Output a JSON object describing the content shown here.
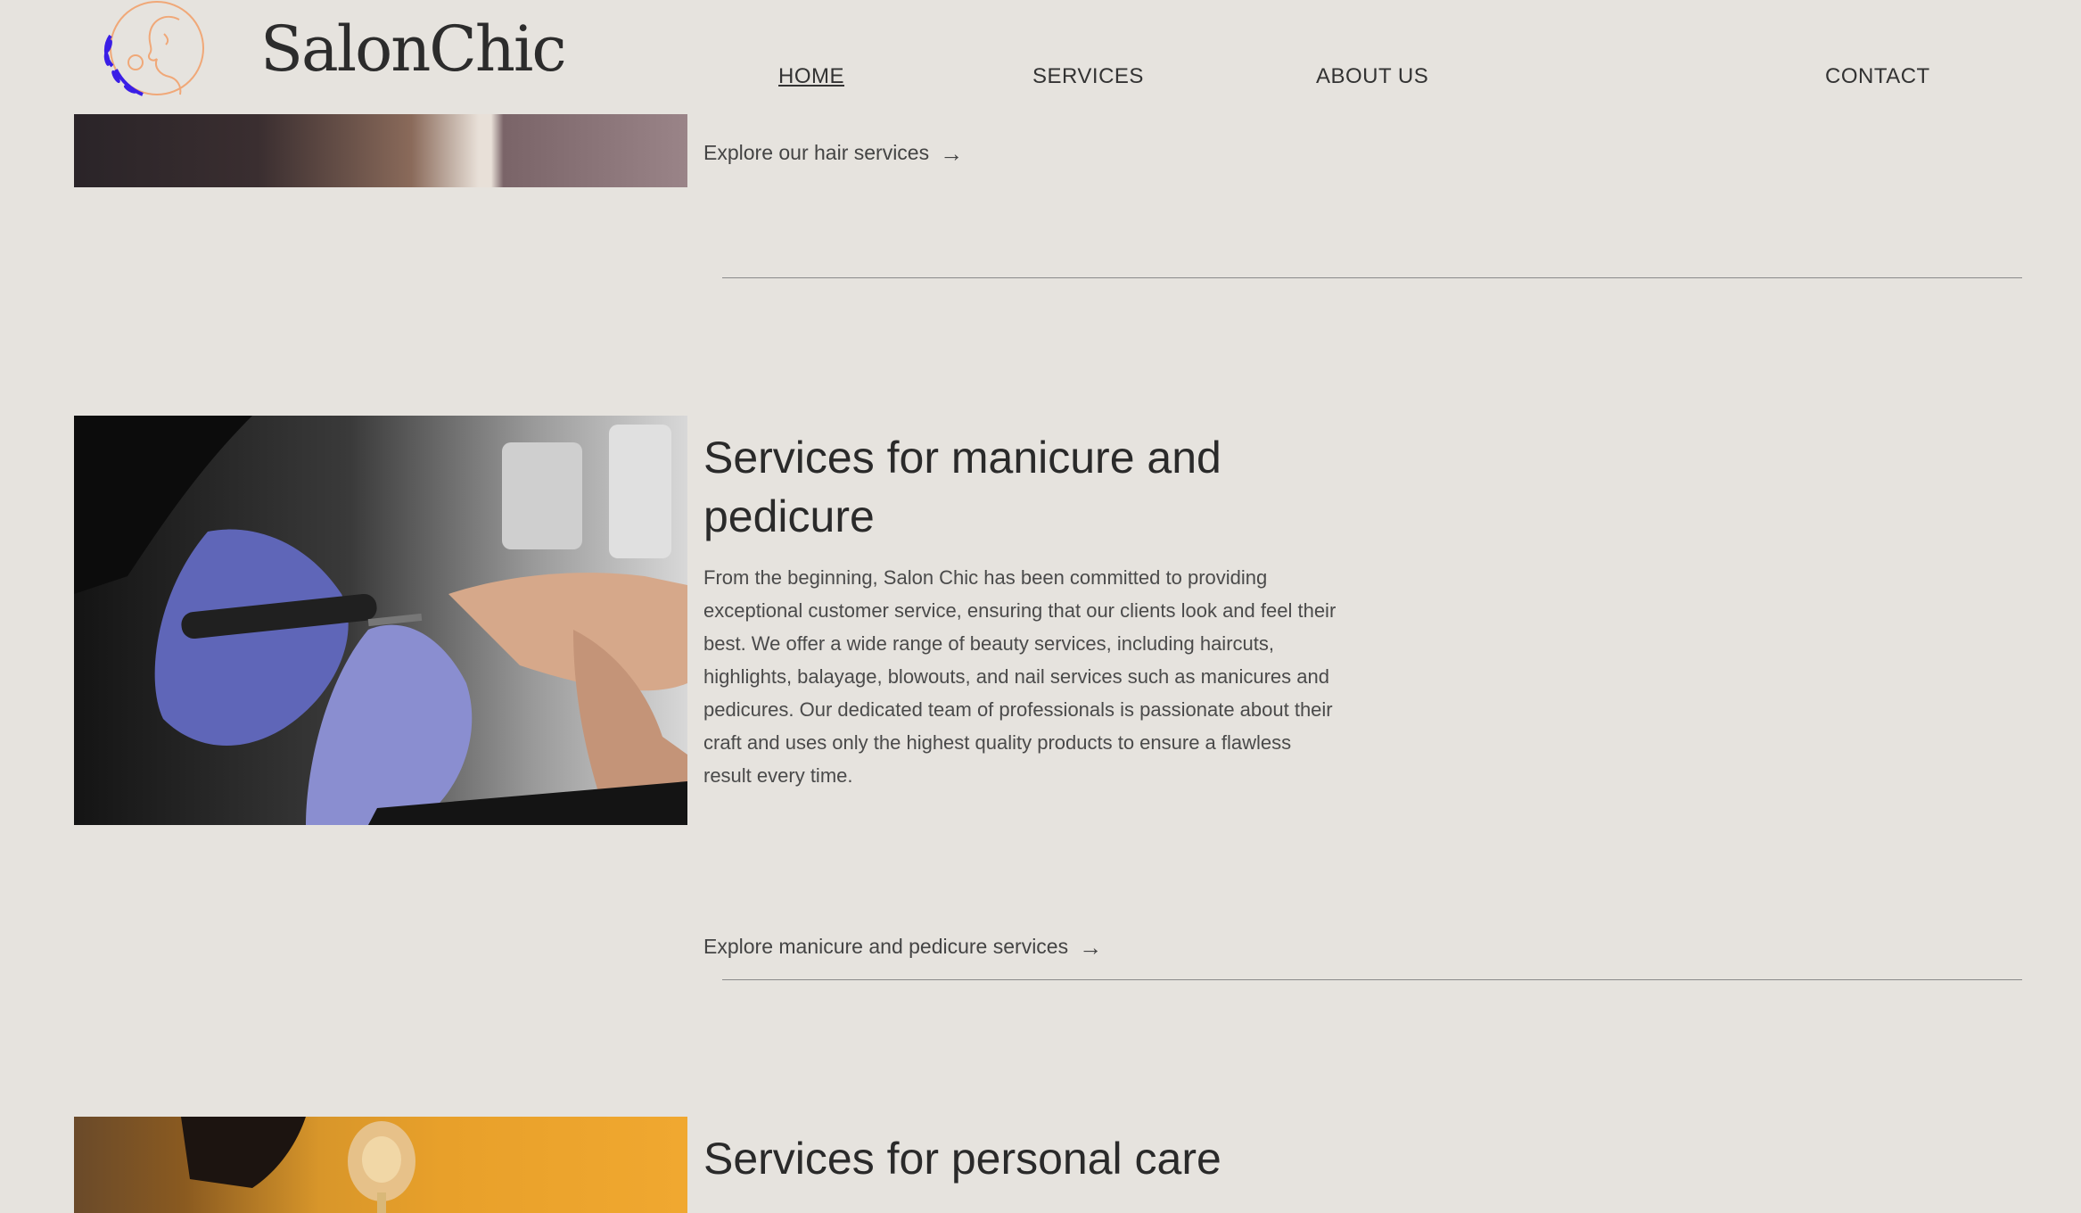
{
  "header": {
    "brand": "SalonChic",
    "nav": [
      "HOME",
      "SERVICES",
      "ABOUT US",
      "CONTACT"
    ],
    "active_nav": "HOME"
  },
  "hair_section": {
    "link_label": "Explore our hair services",
    "link_icon": "arrow-right-icon"
  },
  "manicure_section": {
    "title": "Services for manicure and pedicure",
    "body": "From the beginning, Salon Chic has been committed to providing exceptional customer service, ensuring that our clients look and feel their best. We offer a wide range of beauty services, including haircuts, highlights, balayage, blowouts, and nail services such as manicures and pedicures. Our dedicated team of professionals is passionate about their craft and uses only the highest quality products to ensure a flawless result every time.",
    "link_label": "Explore manicure and pedicure services",
    "link_icon": "arrow-right-icon"
  },
  "personal_section": {
    "title": "Services for personal care"
  },
  "colors": {
    "background": "#e6e3de",
    "text": "#333333",
    "logo_orange": "#f0a878",
    "logo_blue": "#3a1ee6"
  }
}
